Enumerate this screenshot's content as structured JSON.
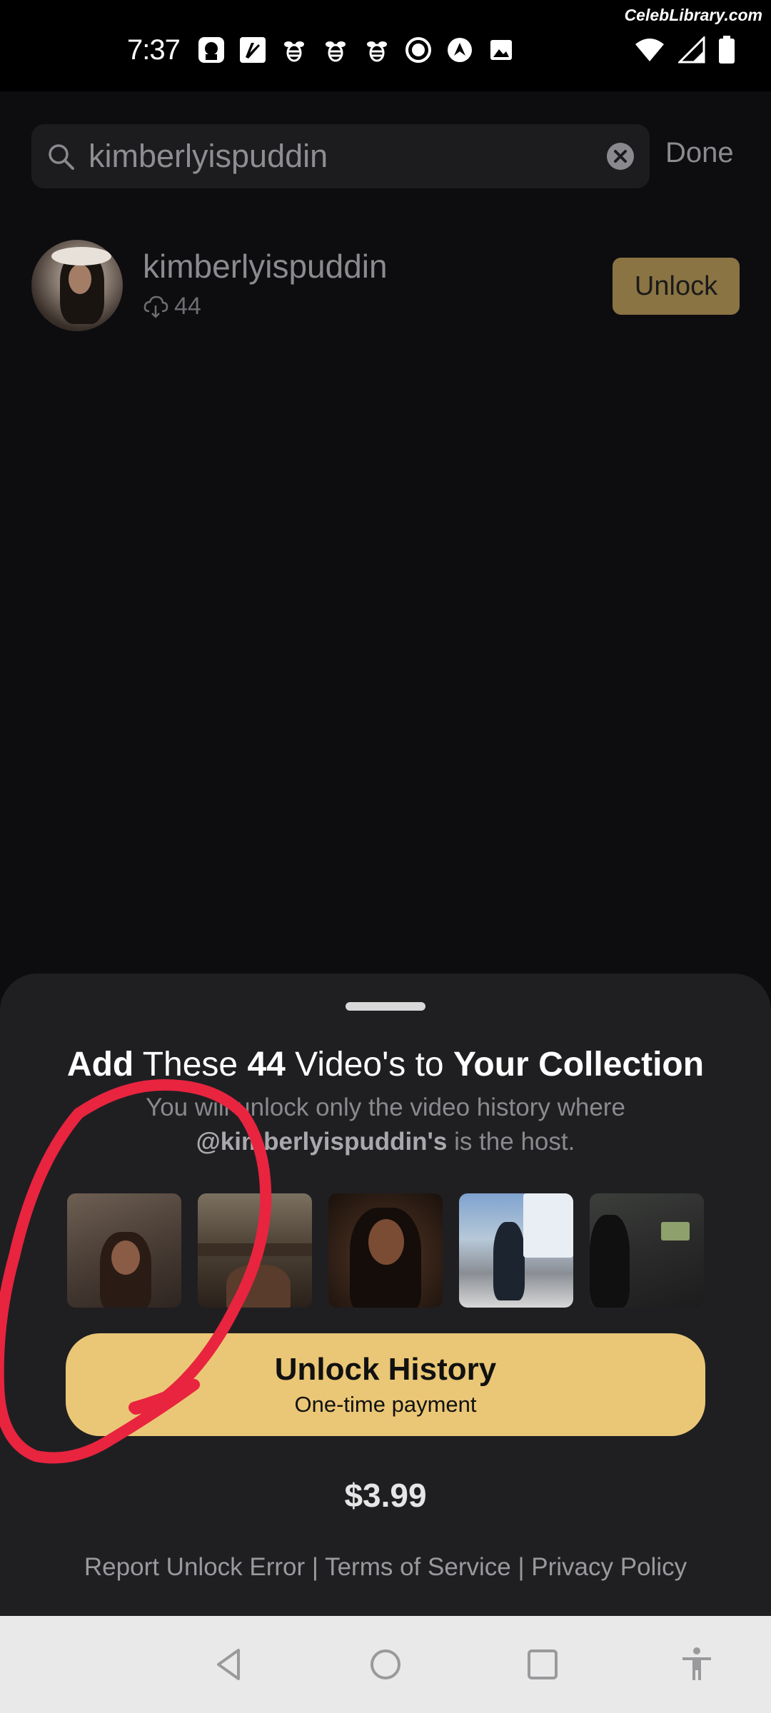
{
  "status_bar": {
    "time": "7:37",
    "watermark": "CelebLibrary.com",
    "notification_icons": [
      "app-icon-1",
      "app-icon-2",
      "bee-icon",
      "bee-icon",
      "bee-icon",
      "record-icon",
      "navigation-icon",
      "image-icon"
    ],
    "system_icons": [
      "wifi-icon",
      "signal-icon",
      "battery-icon"
    ]
  },
  "search": {
    "value": "kimberlyispuddin",
    "done_label": "Done"
  },
  "result": {
    "name": "kimberlyispuddin",
    "count": "44",
    "unlock_label": "Unlock"
  },
  "sheet": {
    "title_parts": {
      "add": "Add",
      "these": " These ",
      "count": "44",
      "videos": " Video's to ",
      "collection": "Your Collection"
    },
    "subtitle_line1": "You will unlock only the video history where",
    "subtitle_handle": "@kimberlyispuddin's",
    "subtitle_tail": " is the host.",
    "unlock_title": "Unlock History",
    "unlock_sub": "One-time payment",
    "price": "$3.99",
    "links": {
      "report": "Report Unlock Error",
      "sep1": " | ",
      "terms": "Terms of Service",
      "sep2": " | ",
      "privacy": "Privacy Policy"
    }
  },
  "colors": {
    "accent": "#eac776",
    "unlock_small": "#8a7443",
    "annotation": "#e8243f"
  }
}
